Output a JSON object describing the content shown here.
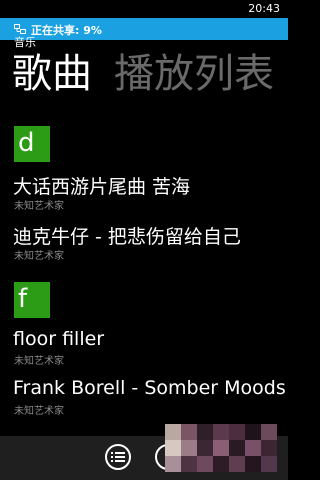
{
  "status_bar": {
    "time": "20:43"
  },
  "banner": {
    "icon": "share-icon",
    "text": "正在共享: 9%",
    "color": "#1ba1e2"
  },
  "app": {
    "title": "音乐"
  },
  "pivot": {
    "items": [
      {
        "label": "歌曲",
        "active": true
      },
      {
        "label": "播放列表",
        "active": false
      }
    ]
  },
  "groups": [
    {
      "letter": "d",
      "color": "#2c9b16",
      "songs": [
        {
          "title": "大话西游片尾曲 苦海",
          "artist": "未知艺术家"
        },
        {
          "title": "迪克牛仔 - 把悲伤留给自己",
          "artist": "未知艺术家"
        }
      ]
    },
    {
      "letter": "f",
      "color": "#2c9b16",
      "songs": [
        {
          "title": "floor filler",
          "artist": "未知艺术家"
        },
        {
          "title": "Frank Borell - Somber Moods",
          "artist": "未知艺术家"
        }
      ]
    }
  ],
  "app_bar": {
    "buttons": [
      {
        "icon": "list-icon"
      },
      {
        "icon": "play-icon"
      }
    ]
  }
}
